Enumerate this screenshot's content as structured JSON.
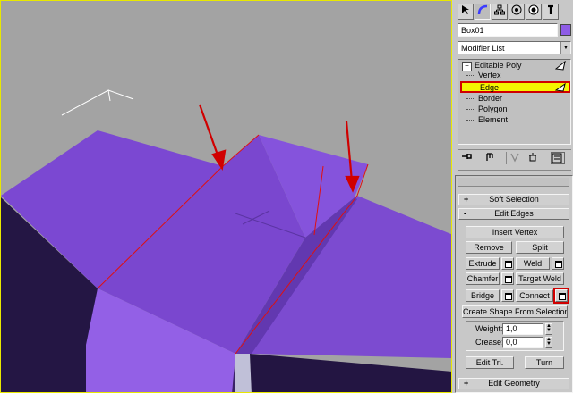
{
  "object_name": "Box01",
  "object_color": "#8e5ce6",
  "modifier_list": {
    "placeholder": "Modifier List"
  },
  "stack": {
    "root": "Editable Poly",
    "items": [
      {
        "label": "Vertex",
        "selected": false
      },
      {
        "label": "Edge",
        "selected": true
      },
      {
        "label": "Border",
        "selected": false
      },
      {
        "label": "Polygon",
        "selected": false
      },
      {
        "label": "Element",
        "selected": false
      }
    ]
  },
  "rollouts": {
    "soft_selection": {
      "sign": "+",
      "title": "Soft Selection"
    },
    "edit_edges": {
      "sign": "-",
      "title": "Edit Edges"
    },
    "edit_geometry": {
      "sign": "+",
      "title": "Edit Geometry"
    }
  },
  "edit_edges": {
    "insert_vertex": "Insert Vertex",
    "remove": "Remove",
    "split": "Split",
    "extrude": "Extrude",
    "weld": "Weld",
    "chamfer": "Chamfer",
    "target_weld": "Target Weld",
    "bridge": "Bridge",
    "connect": "Connect",
    "create_shape": "Create Shape From Selection",
    "weight_label": "Weight:",
    "weight_value": "1,0",
    "crease_label": "Crease:",
    "crease_value": "0,0",
    "edit_tri": "Edit Tri.",
    "turn": "Turn"
  },
  "colors": {
    "viewport_bg": "#a3a3a3",
    "mesh_top": "#7c4ad0",
    "selection_highlight": "#f4f400",
    "annotation_red": "#d00000"
  }
}
